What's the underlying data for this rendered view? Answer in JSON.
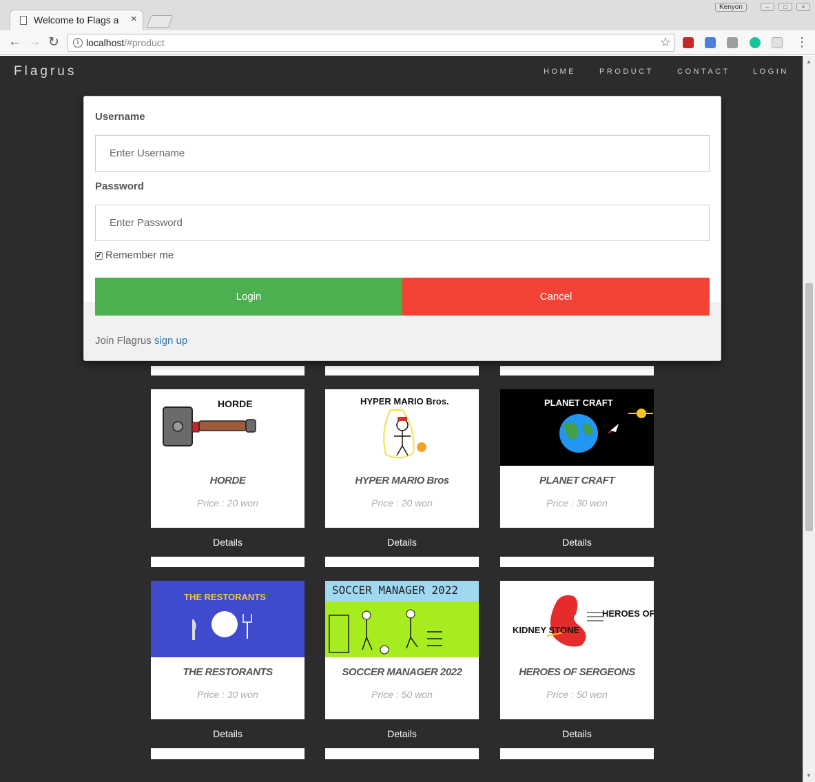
{
  "browser": {
    "tab_title": "Welcome to Flags a",
    "tab_close": "×",
    "window_user": "Kenyon",
    "url_host": "localhost",
    "url_path": "/#product",
    "star": "☆",
    "back": "←",
    "forward": "→",
    "reload": "↻",
    "info": "i",
    "menu": "⋮"
  },
  "navbar": {
    "brand": "Flagrus",
    "links": [
      "HOME",
      "PRODUCT",
      "CONTACT",
      "LOGIN"
    ]
  },
  "login_modal": {
    "username_label": "Username",
    "username_placeholder": "Enter Username",
    "password_label": "Password",
    "password_placeholder": "Enter Password",
    "remember_label": "Remember me",
    "remember_checked": true,
    "login_label": "Login",
    "cancel_label": "Cancel",
    "join_text": "Join Flagrus",
    "signup_link": "sign up",
    "colors": {
      "login": "#4caf50",
      "cancel": "#f44336",
      "link": "#2a74b8"
    }
  },
  "products": [
    {
      "image_text": "HORDE",
      "title": "HORDE",
      "price": "Price : 20 won",
      "button": "Details"
    },
    {
      "image_text": "HYPER MARIO Bros.",
      "title": "HYPER MARIO Bros",
      "price": "Price : 20 won",
      "button": "Details"
    },
    {
      "image_text": "PLANET CRAFT",
      "title": "PLANET CRAFT",
      "price": "Price : 30 won",
      "button": "Details"
    },
    {
      "image_text": "THE RESTORANTS",
      "title": "THE RESTORANTS",
      "price": "Price : 30 won",
      "button": "Details"
    },
    {
      "image_text": "SOCCER MANAGER 2022",
      "title": "SOCCER MANAGER 2022",
      "price": "Price : 50 won",
      "button": "Details"
    },
    {
      "image_text": "HEROES OF SERGEONS",
      "image_subtext": "KIDNEY STONE",
      "title": "HEROES OF SERGEONS",
      "price": "Price : 50 won",
      "button": "Details"
    }
  ]
}
